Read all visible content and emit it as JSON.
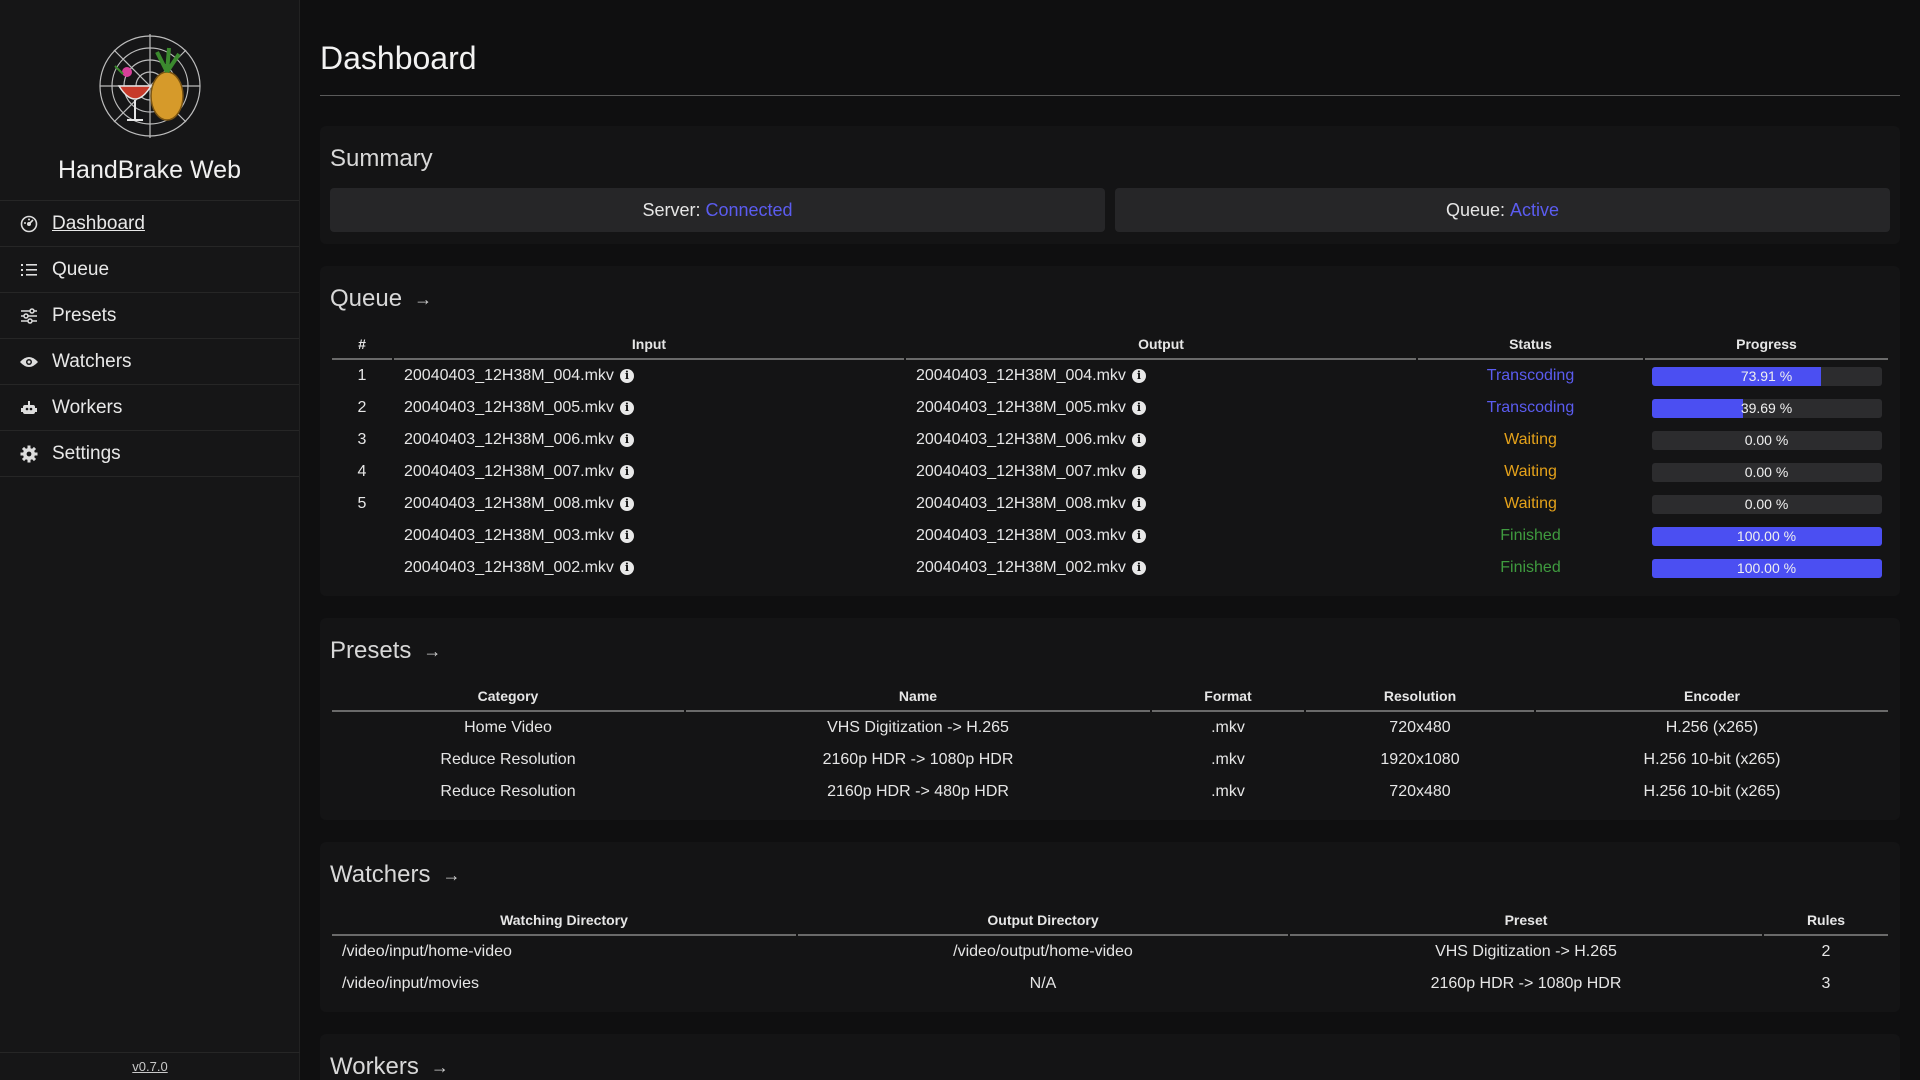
{
  "sidebar": {
    "app_title": "HandBrake Web",
    "version": "v0.7.0",
    "items": [
      {
        "label": "Dashboard",
        "icon": "dashboard-icon",
        "active": true
      },
      {
        "label": "Queue",
        "icon": "list-icon"
      },
      {
        "label": "Presets",
        "icon": "sliders-icon"
      },
      {
        "label": "Watchers",
        "icon": "eye-icon"
      },
      {
        "label": "Workers",
        "icon": "robot-icon"
      },
      {
        "label": "Settings",
        "icon": "gear-icon"
      }
    ]
  },
  "page": {
    "title": "Dashboard"
  },
  "summary": {
    "title": "Summary",
    "server_label": "Server:",
    "server_value": "Connected",
    "queue_label": "Queue:",
    "queue_value": "Active"
  },
  "queue": {
    "title": "Queue",
    "headers": [
      "#",
      "Input",
      "Output",
      "Status",
      "Progress"
    ],
    "rows": [
      {
        "num": "1",
        "input": "20040403_12H38M_004.mkv",
        "output": "20040403_12H38M_004.mkv",
        "status": "Transcoding",
        "progress": 73.91,
        "progress_text": "73.91 %"
      },
      {
        "num": "2",
        "input": "20040403_12H38M_005.mkv",
        "output": "20040403_12H38M_005.mkv",
        "status": "Transcoding",
        "progress": 39.69,
        "progress_text": "39.69 %"
      },
      {
        "num": "3",
        "input": "20040403_12H38M_006.mkv",
        "output": "20040403_12H38M_006.mkv",
        "status": "Waiting",
        "progress": 0,
        "progress_text": "0.00 %"
      },
      {
        "num": "4",
        "input": "20040403_12H38M_007.mkv",
        "output": "20040403_12H38M_007.mkv",
        "status": "Waiting",
        "progress": 0,
        "progress_text": "0.00 %"
      },
      {
        "num": "5",
        "input": "20040403_12H38M_008.mkv",
        "output": "20040403_12H38M_008.mkv",
        "status": "Waiting",
        "progress": 0,
        "progress_text": "0.00 %"
      },
      {
        "num": "",
        "input": "20040403_12H38M_003.mkv",
        "output": "20040403_12H38M_003.mkv",
        "status": "Finished",
        "progress": 100,
        "progress_text": "100.00 %"
      },
      {
        "num": "",
        "input": "20040403_12H38M_002.mkv",
        "output": "20040403_12H38M_002.mkv",
        "status": "Finished",
        "progress": 100,
        "progress_text": "100.00 %"
      }
    ]
  },
  "presets": {
    "title": "Presets",
    "headers": [
      "Category",
      "Name",
      "Format",
      "Resolution",
      "Encoder"
    ],
    "rows": [
      [
        "Home Video",
        "VHS Digitization -> H.265",
        ".mkv",
        "720x480",
        "H.256 (x265)"
      ],
      [
        "Reduce Resolution",
        "2160p HDR -> 1080p HDR",
        ".mkv",
        "1920x1080",
        "H.256 10-bit (x265)"
      ],
      [
        "Reduce Resolution",
        "2160p HDR -> 480p HDR",
        ".mkv",
        "720x480",
        "H.256 10-bit (x265)"
      ]
    ]
  },
  "watchers": {
    "title": "Watchers",
    "headers": [
      "Watching Directory",
      "Output Directory",
      "Preset",
      "Rules"
    ],
    "rows": [
      [
        "/video/input/home-video",
        "/video/output/home-video",
        "VHS Digitization -> H.265",
        "2"
      ],
      [
        "/video/input/movies",
        "N/A",
        "2160p HDR -> 1080p HDR",
        "3"
      ]
    ]
  },
  "workers": {
    "title": "Workers"
  },
  "colors": {
    "accent": "#4b4ff2",
    "transcoding": "#5b5cf0",
    "waiting": "#e5a21a",
    "finished": "#3f9b3f"
  }
}
